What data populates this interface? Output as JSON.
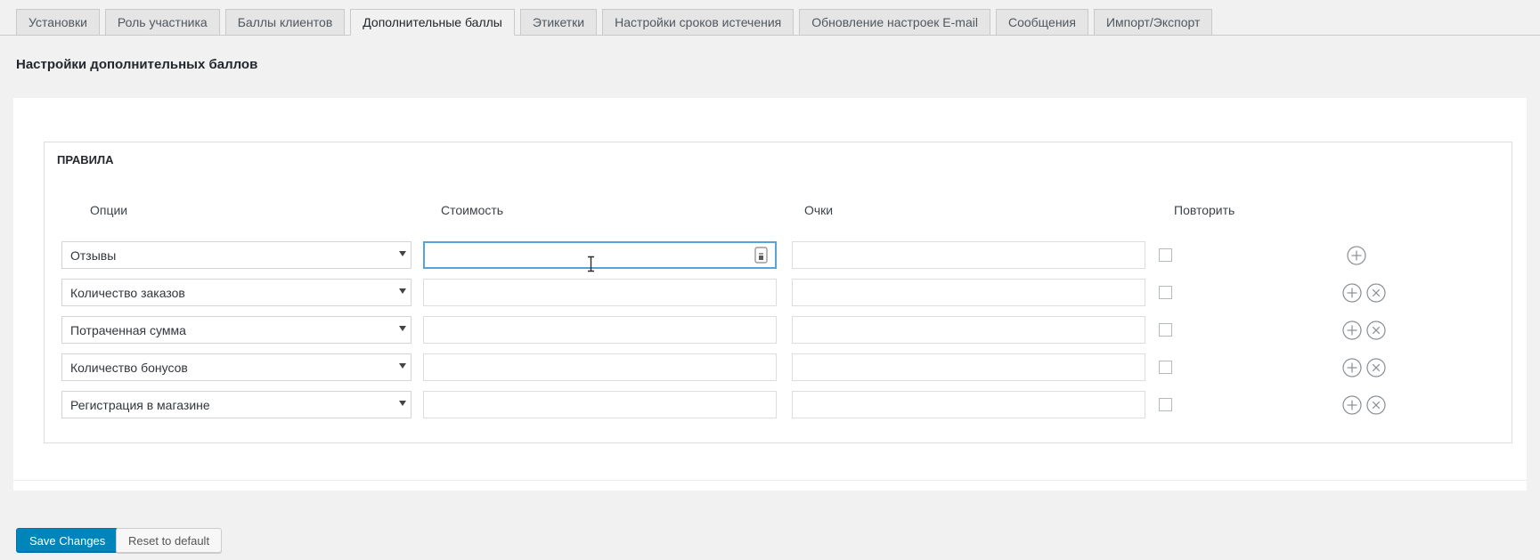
{
  "tabs": {
    "items": [
      {
        "label": "Установки",
        "active": false
      },
      {
        "label": "Роль участника",
        "active": false
      },
      {
        "label": "Баллы клиентов",
        "active": false
      },
      {
        "label": "Дополнительные баллы",
        "active": true
      },
      {
        "label": "Этикетки",
        "active": false
      },
      {
        "label": "Настройки сроков истечения",
        "active": false
      },
      {
        "label": "Обновление настроек E-mail",
        "active": false
      },
      {
        "label": "Сообщения",
        "active": false
      },
      {
        "label": "Импорт/Экспорт",
        "active": false
      }
    ]
  },
  "page_title": "Настройки дополнительных баллов",
  "rules": {
    "legend": "ПРАВИЛА",
    "columns": {
      "options": "Опции",
      "cost": "Стоимость",
      "points": "Очки",
      "repeat": "Повторить"
    },
    "rows": [
      {
        "option": "Отзывы",
        "cost_value": "",
        "points_value": "",
        "repeat_checked": false,
        "cost_focused": true,
        "removable": false
      },
      {
        "option": "Количество заказов",
        "cost_value": "",
        "points_value": "",
        "repeat_checked": false,
        "cost_focused": false,
        "removable": true
      },
      {
        "option": "Потраченная сумма",
        "cost_value": "",
        "points_value": "",
        "repeat_checked": false,
        "cost_focused": false,
        "removable": true
      },
      {
        "option": "Количество бонусов",
        "cost_value": "",
        "points_value": "",
        "repeat_checked": false,
        "cost_focused": false,
        "removable": true
      },
      {
        "option": "Регистрация в магазине",
        "cost_value": "",
        "points_value": "",
        "repeat_checked": false,
        "cost_focused": false,
        "removable": true
      }
    ]
  },
  "actions": {
    "save_label": "Save Changes",
    "reset_label": "Reset to default"
  },
  "colors": {
    "primary_button": "#0085ba",
    "primary_button_border": "#0073aa",
    "focus_border": "#56a3db"
  }
}
